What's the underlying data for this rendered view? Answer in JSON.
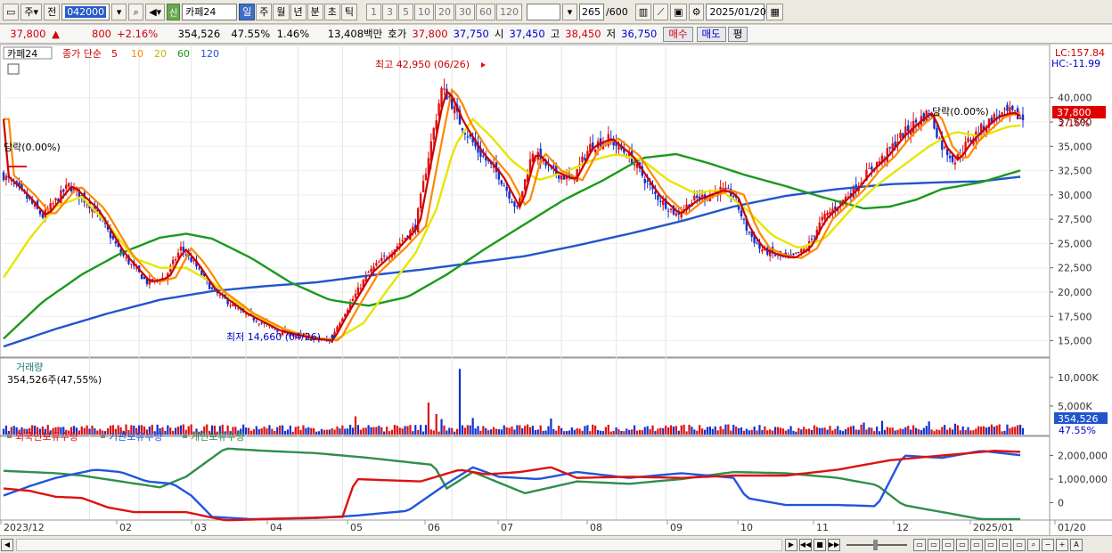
{
  "toolbar": {
    "mode1": "주",
    "mode2": "전",
    "code": "042000",
    "name": "카페24",
    "badge_new": "신",
    "periods": [
      "일",
      "주",
      "월",
      "년",
      "분",
      "초",
      "틱"
    ],
    "period_active": "일",
    "minutes": [
      "1",
      "3",
      "5",
      "10",
      "20",
      "30",
      "60",
      "120"
    ],
    "count": "265",
    "count_total": "/600",
    "date": "2025/01/20"
  },
  "quote": {
    "price": "37,800",
    "change": "800",
    "change_pct": "+2.16%",
    "volume": "354,526",
    "vol_ratio": "47.55%",
    "turnover": "1.46%",
    "amount": "13,408백만",
    "ask_label": "호가",
    "ask": "37,800",
    "bid": "37,750",
    "open_label": "시",
    "open": "37,450",
    "high_label": "고",
    "high": "38,450",
    "low_label": "저",
    "low": "36,750",
    "buy_label": "매수",
    "sell_label": "매도",
    "avg_label": "평"
  },
  "chart_data": {
    "type": "candlestick",
    "price_legend": {
      "name": "카페24",
      "ma_label": "종가 단순",
      "periods": [
        "5",
        "10",
        "20",
        "60",
        "120"
      ],
      "colors": [
        "#cc0000",
        "#ff8800",
        "#e6e600",
        "#1a9a1a",
        "#2255cc"
      ]
    },
    "price_axis_ticks": [
      40000,
      37500,
      35000,
      32500,
      30000,
      27500,
      25000,
      22500,
      20000,
      17500,
      15000
    ],
    "price_axis_labels": [
      "40,000",
      "37,500",
      "35,000",
      "32,500",
      "30,000",
      "27,500",
      "25,000",
      "22,500",
      "20,000",
      "17,500",
      "15,000"
    ],
    "price_range": [
      13400,
      45200
    ],
    "lc": "LC:157.84",
    "hc": "HC:-11.99",
    "last_price_label": "37,800",
    "last_change_label": "2.16%",
    "high_label": "최고 42,950 (06/26)",
    "low_label": "최저 14,660 (04/26)",
    "dangrak_label": "당락(0.00%)",
    "x_labels": [
      "2023/12",
      "02",
      "03",
      "04",
      "05",
      "06",
      "07",
      "08",
      "09",
      "10",
      "11",
      "12",
      "2025/01",
      "01/20"
    ],
    "close_path": [
      [
        0,
        32000
      ],
      [
        8,
        30000
      ],
      [
        15,
        27800
      ],
      [
        25,
        31000
      ],
      [
        35,
        28500
      ],
      [
        45,
        24000
      ],
      [
        55,
        21000
      ],
      [
        62,
        21500
      ],
      [
        68,
        24500
      ],
      [
        73,
        23000
      ],
      [
        80,
        20200
      ],
      [
        92,
        17800
      ],
      [
        105,
        16000
      ],
      [
        118,
        15200
      ],
      [
        125,
        15000
      ],
      [
        130,
        17500
      ],
      [
        140,
        22000
      ],
      [
        150,
        24500
      ],
      [
        158,
        26800
      ],
      [
        163,
        34000
      ],
      [
        168,
        40800
      ],
      [
        171,
        40000
      ],
      [
        175,
        37500
      ],
      [
        182,
        34500
      ],
      [
        190,
        32000
      ],
      [
        197,
        28500
      ],
      [
        203,
        34500
      ],
      [
        210,
        32500
      ],
      [
        218,
        31500
      ],
      [
        225,
        35000
      ],
      [
        232,
        35800
      ],
      [
        240,
        34000
      ],
      [
        250,
        30000
      ],
      [
        258,
        28000
      ],
      [
        265,
        29500
      ],
      [
        275,
        30500
      ],
      [
        280,
        30000
      ],
      [
        285,
        26500
      ],
      [
        290,
        24500
      ],
      [
        296,
        23800
      ],
      [
        302,
        23500
      ],
      [
        308,
        24500
      ],
      [
        314,
        27500
      ],
      [
        320,
        29000
      ],
      [
        326,
        30500
      ],
      [
        332,
        32500
      ],
      [
        338,
        34000
      ],
      [
        344,
        36000
      ],
      [
        350,
        37500
      ],
      [
        355,
        38500
      ],
      [
        360,
        35000
      ],
      [
        365,
        33500
      ],
      [
        370,
        35500
      ],
      [
        375,
        36800
      ],
      [
        380,
        38000
      ],
      [
        386,
        38500
      ],
      [
        391,
        37800
      ]
    ],
    "ma20_path": [
      [
        0,
        21500
      ],
      [
        10,
        25500
      ],
      [
        20,
        28800
      ],
      [
        30,
        29800
      ],
      [
        40,
        27000
      ],
      [
        50,
        23500
      ],
      [
        60,
        22500
      ],
      [
        70,
        22500
      ],
      [
        80,
        21000
      ],
      [
        90,
        18800
      ],
      [
        100,
        17000
      ],
      [
        110,
        16000
      ],
      [
        120,
        15100
      ],
      [
        128,
        15200
      ],
      [
        138,
        16800
      ],
      [
        148,
        20500
      ],
      [
        158,
        24000
      ],
      [
        166,
        28500
      ],
      [
        173,
        35000
      ],
      [
        180,
        37800
      ],
      [
        187,
        36000
      ],
      [
        195,
        33500
      ],
      [
        205,
        31500
      ],
      [
        215,
        32300
      ],
      [
        225,
        33500
      ],
      [
        235,
        34200
      ],
      [
        245,
        33600
      ],
      [
        255,
        31500
      ],
      [
        265,
        30200
      ],
      [
        275,
        30500
      ],
      [
        285,
        28500
      ],
      [
        295,
        25800
      ],
      [
        305,
        24500
      ],
      [
        315,
        25500
      ],
      [
        325,
        28500
      ],
      [
        335,
        31000
      ],
      [
        345,
        33000
      ],
      [
        355,
        35000
      ],
      [
        365,
        36500
      ],
      [
        375,
        36000
      ],
      [
        385,
        37000
      ],
      [
        391,
        37200
      ]
    ],
    "ma60_path": [
      [
        0,
        15200
      ],
      [
        15,
        19000
      ],
      [
        30,
        21800
      ],
      [
        45,
        24000
      ],
      [
        60,
        25600
      ],
      [
        70,
        26000
      ],
      [
        80,
        25500
      ],
      [
        95,
        23500
      ],
      [
        110,
        21000
      ],
      [
        125,
        19200
      ],
      [
        140,
        18600
      ],
      [
        155,
        19500
      ],
      [
        170,
        21800
      ],
      [
        185,
        24500
      ],
      [
        200,
        27000
      ],
      [
        215,
        29500
      ],
      [
        230,
        31500
      ],
      [
        245,
        33800
      ],
      [
        258,
        34200
      ],
      [
        270,
        33300
      ],
      [
        285,
        32000
      ],
      [
        300,
        30900
      ],
      [
        315,
        29700
      ],
      [
        330,
        28600
      ],
      [
        340,
        28800
      ],
      [
        350,
        29500
      ],
      [
        360,
        30600
      ],
      [
        375,
        31300
      ],
      [
        391,
        32600
      ]
    ],
    "ma120_path": [
      [
        0,
        14400
      ],
      [
        20,
        16200
      ],
      [
        40,
        17800
      ],
      [
        60,
        19200
      ],
      [
        80,
        20100
      ],
      [
        100,
        20600
      ],
      [
        120,
        21000
      ],
      [
        140,
        21700
      ],
      [
        160,
        22300
      ],
      [
        180,
        23000
      ],
      [
        200,
        23700
      ],
      [
        220,
        24800
      ],
      [
        240,
        26000
      ],
      [
        260,
        27300
      ],
      [
        280,
        28800
      ],
      [
        300,
        29900
      ],
      [
        320,
        30600
      ],
      [
        340,
        31100
      ],
      [
        360,
        31300
      ],
      [
        375,
        31400
      ],
      [
        391,
        31900
      ]
    ],
    "volume": {
      "title": "거래량",
      "current": "354,526주(47,55%)",
      "axis_labels": [
        "10,000K",
        "5,000K"
      ],
      "axis_ticks": [
        10000,
        5000
      ],
      "max": 12000,
      "last_label": "354,526",
      "last_pct": "47.55%",
      "spikes": [
        [
          135,
          3200
        ],
        [
          163,
          5600
        ],
        [
          166,
          3600
        ],
        [
          168,
          2700
        ],
        [
          175,
          11500
        ],
        [
          180,
          2900
        ],
        [
          210,
          2800
        ],
        [
          330,
          2100
        ],
        [
          337,
          2400
        ],
        [
          355,
          2300
        ],
        [
          365,
          1900
        ]
      ]
    },
    "holdings": {
      "series": [
        {
          "name": "외국인보유수량",
          "color": "#dd1111"
        },
        {
          "name": "기관보유수량",
          "color": "#2255dd"
        },
        {
          "name": "개인보유수량",
          "color": "#2f8f4a"
        }
      ],
      "axis_labels": [
        "2,000,000",
        "1,000,000",
        "0"
      ],
      "axis_ticks": [
        2000000,
        1000000,
        0
      ],
      "range": [
        -700000,
        2700000
      ],
      "foreign": [
        [
          0,
          600000
        ],
        [
          10,
          500000
        ],
        [
          20,
          250000
        ],
        [
          30,
          200000
        ],
        [
          40,
          -200000
        ],
        [
          50,
          -400000
        ],
        [
          70,
          -400000
        ],
        [
          85,
          -750000
        ],
        [
          100,
          -700000
        ],
        [
          130,
          -600000
        ],
        [
          135,
          1000000
        ],
        [
          160,
          900000
        ],
        [
          175,
          1400000
        ],
        [
          185,
          1200000
        ],
        [
          198,
          1300000
        ],
        [
          210,
          1500000
        ],
        [
          220,
          1050000
        ],
        [
          240,
          1100000
        ],
        [
          260,
          1050000
        ],
        [
          280,
          1150000
        ],
        [
          300,
          1150000
        ],
        [
          320,
          1400000
        ],
        [
          340,
          1800000
        ],
        [
          360,
          2000000
        ],
        [
          380,
          2200000
        ],
        [
          391,
          2150000
        ]
      ],
      "institution": [
        [
          0,
          300000
        ],
        [
          10,
          700000
        ],
        [
          20,
          1050000
        ],
        [
          35,
          1400000
        ],
        [
          45,
          1300000
        ],
        [
          55,
          900000
        ],
        [
          65,
          800000
        ],
        [
          72,
          300000
        ],
        [
          80,
          -600000
        ],
        [
          95,
          -700000
        ],
        [
          120,
          -650000
        ],
        [
          135,
          -550000
        ],
        [
          155,
          -350000
        ],
        [
          170,
          800000
        ],
        [
          180,
          1500000
        ],
        [
          190,
          1100000
        ],
        [
          205,
          1000000
        ],
        [
          220,
          1300000
        ],
        [
          240,
          1050000
        ],
        [
          260,
          1250000
        ],
        [
          280,
          1050000
        ],
        [
          285,
          200000
        ],
        [
          300,
          -100000
        ],
        [
          320,
          -100000
        ],
        [
          335,
          -150000
        ],
        [
          345,
          2000000
        ],
        [
          360,
          1900000
        ],
        [
          375,
          2200000
        ],
        [
          391,
          2000000
        ]
      ],
      "individual": [
        [
          0,
          1350000
        ],
        [
          10,
          1300000
        ],
        [
          20,
          1250000
        ],
        [
          30,
          1150000
        ],
        [
          45,
          900000
        ],
        [
          60,
          650000
        ],
        [
          70,
          1100000
        ],
        [
          85,
          2300000
        ],
        [
          100,
          2200000
        ],
        [
          120,
          2100000
        ],
        [
          140,
          1900000
        ],
        [
          165,
          1600000
        ],
        [
          170,
          600000
        ],
        [
          180,
          1300000
        ],
        [
          200,
          400000
        ],
        [
          220,
          900000
        ],
        [
          240,
          800000
        ],
        [
          260,
          1000000
        ],
        [
          280,
          1300000
        ],
        [
          300,
          1250000
        ],
        [
          320,
          1050000
        ],
        [
          335,
          750000
        ],
        [
          345,
          -100000
        ],
        [
          360,
          -400000
        ],
        [
          375,
          -700000
        ],
        [
          391,
          -700000
        ]
      ]
    }
  },
  "nav": {
    "icons": [
      "rewind-icon",
      "prev-icon",
      "stop-icon",
      "next-icon"
    ]
  }
}
